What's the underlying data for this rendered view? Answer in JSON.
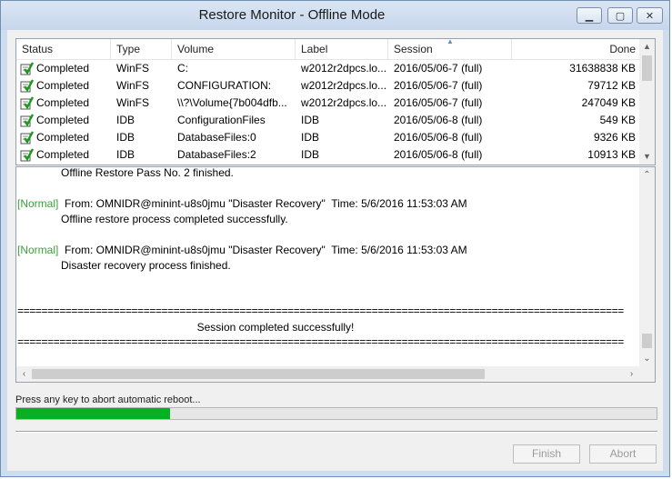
{
  "window": {
    "title": "Restore Monitor - Offline Mode",
    "minimize_glyph": "▁",
    "maximize_glyph": "▢",
    "close_glyph": "✕"
  },
  "list": {
    "columns": [
      "Status",
      "Type",
      "Volume",
      "Label",
      "Session",
      "Done"
    ],
    "rows": [
      {
        "status": "Completed",
        "type": "WinFS",
        "volume": "C:",
        "label": "w2012r2dpcs.lo...",
        "session": "2016/05/06-7  (full)",
        "done": "31638838 KB"
      },
      {
        "status": "Completed",
        "type": "WinFS",
        "volume": "CONFIGURATION:",
        "label": "w2012r2dpcs.lo...",
        "session": "2016/05/06-7  (full)",
        "done": "79712 KB"
      },
      {
        "status": "Completed",
        "type": "WinFS",
        "volume": "\\\\?\\Volume{7b004dfb...",
        "label": "w2012r2dpcs.lo...",
        "session": "2016/05/06-7  (full)",
        "done": "247049 KB"
      },
      {
        "status": "Completed",
        "type": "IDB",
        "volume": "ConfigurationFiles",
        "label": "IDB",
        "session": "2016/05/06-8  (full)",
        "done": "549 KB"
      },
      {
        "status": "Completed",
        "type": "IDB",
        "volume": "DatabaseFiles:0",
        "label": "IDB",
        "session": "2016/05/06-8  (full)",
        "done": "9326 KB"
      },
      {
        "status": "Completed",
        "type": "IDB",
        "volume": "DatabaseFiles:2",
        "label": "IDB",
        "session": "2016/05/06-8  (full)",
        "done": "10913 KB"
      }
    ]
  },
  "log": {
    "lines": [
      {
        "indent": true,
        "text": "Offline Restore Pass No. 2 finished."
      },
      {
        "text": ""
      },
      {
        "tag": "[Normal]",
        "text": "  From: OMNIDR@minint-u8s0jmu \"Disaster Recovery\"  Time: 5/6/2016 11:53:03 AM"
      },
      {
        "indent": true,
        "text": "Offline restore process completed successfully."
      },
      {
        "text": ""
      },
      {
        "tag": "[Normal]",
        "text": "  From: OMNIDR@minint-u8s0jmu \"Disaster Recovery\"  Time: 5/6/2016 11:53:03 AM"
      },
      {
        "indent": true,
        "text": "Disaster recovery process finished."
      },
      {
        "text": ""
      },
      {
        "text": ""
      },
      {
        "eq": true,
        "text": "========================================================================================================="
      },
      {
        "center": true,
        "text": "Session completed successfully!"
      },
      {
        "eq": true,
        "text": "========================================================================================================="
      }
    ]
  },
  "footer": {
    "prompt": "Press any key to abort automatic reboot...",
    "progress_fraction": 0.24,
    "finish_label": "Finish",
    "abort_label": "Abort"
  }
}
